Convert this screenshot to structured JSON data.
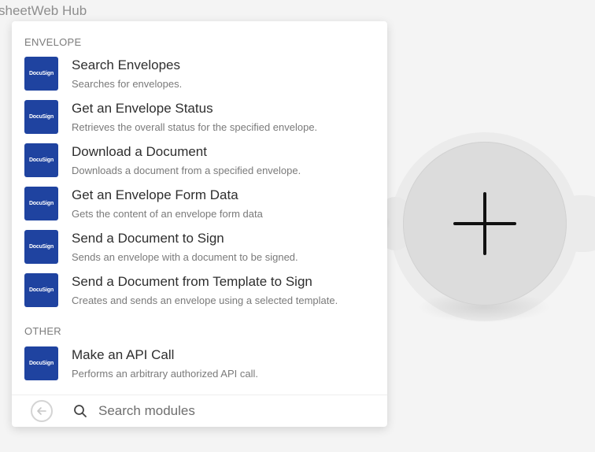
{
  "breadcrumb": {
    "text": "sheetWeb Hub"
  },
  "popup": {
    "sections": [
      {
        "label": "ENVELOPE",
        "items": [
          {
            "logo": "DocuSign",
            "title": "Search Envelopes",
            "description": "Searches for envelopes."
          },
          {
            "logo": "DocuSign",
            "title": "Get an Envelope Status",
            "description": "Retrieves the overall status for the specified envelope."
          },
          {
            "logo": "DocuSign",
            "title": "Download a Document",
            "description": "Downloads a document from a specified envelope."
          },
          {
            "logo": "DocuSign",
            "title": "Get an Envelope Form Data",
            "description": "Gets the content of an envelope form data"
          },
          {
            "logo": "DocuSign",
            "title": "Send a Document to Sign",
            "description": "Sends an envelope with a document to be signed."
          },
          {
            "logo": "DocuSign",
            "title": "Send a Document from Template to Sign",
            "description": "Creates and sends an envelope using a selected template."
          }
        ]
      },
      {
        "label": "OTHER",
        "items": [
          {
            "logo": "DocuSign",
            "title": "Make an API Call",
            "description": "Performs an arbitrary authorized API call."
          }
        ]
      }
    ],
    "footer": {
      "back_icon": "arrow-left-circle-icon",
      "search_icon": "search-icon",
      "search_placeholder": "Search modules",
      "search_value": ""
    }
  },
  "canvas": {
    "add_node_icon": "plus-icon"
  },
  "colors": {
    "docusign_brand": "#1f43a0",
    "panel_bg": "#ffffff",
    "canvas_bg": "#f4f4f4",
    "node_fill": "#dcdcdc"
  }
}
